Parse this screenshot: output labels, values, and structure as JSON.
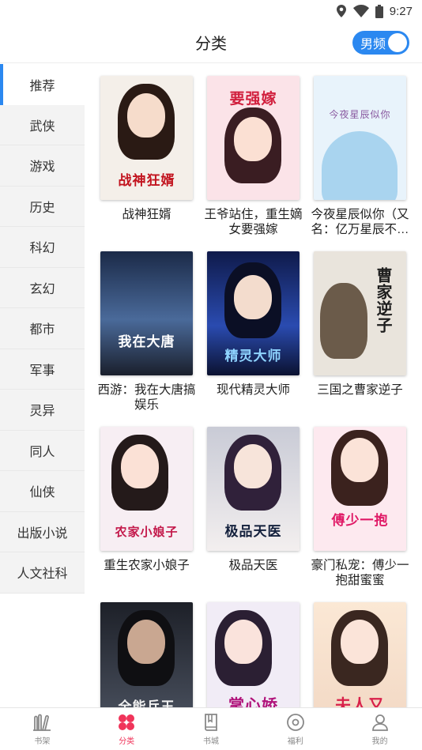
{
  "status_bar": {
    "time": "9:27"
  },
  "header": {
    "title": "分类",
    "toggle_label": "男频"
  },
  "sidebar": {
    "items": [
      {
        "label": "推荐"
      },
      {
        "label": "武侠"
      },
      {
        "label": "游戏"
      },
      {
        "label": "历史"
      },
      {
        "label": "科幻"
      },
      {
        "label": "玄幻"
      },
      {
        "label": "都市"
      },
      {
        "label": "军事"
      },
      {
        "label": "灵异"
      },
      {
        "label": "同人"
      },
      {
        "label": "仙侠"
      },
      {
        "label": "出版小说"
      },
      {
        "label": "人文社科"
      }
    ]
  },
  "books": [
    {
      "title": "战神狂婿",
      "cover_text": "战神狂婿",
      "bg": "#f4efe9",
      "accent": "#c2141f"
    },
    {
      "title": "王爷站住，重生嫡女要强嫁",
      "cover_text": "要强嫁",
      "bg": "#fbe3e8",
      "accent": "#d11f3d"
    },
    {
      "title": "今夜星辰似你（又名：亿万星辰不…",
      "cover_text": "今夜星辰似你",
      "bg": "#e8f3fb",
      "accent": "#8a5aa0"
    },
    {
      "title": "西游：我在大唐搞娱乐",
      "cover_text": "我在大唐",
      "bg": "#2a3f66",
      "accent": "#ffffff"
    },
    {
      "title": "现代精灵大师",
      "cover_text": "精灵大师",
      "bg": "#1b2a6b",
      "accent": "#8fd4ff"
    },
    {
      "title": "三国之曹家逆子",
      "cover_text": "曹家逆子",
      "bg": "#e9e4dc",
      "accent": "#1d1d1d"
    },
    {
      "title": "重生农家小娘子",
      "cover_text": "农家小娘子",
      "bg": "#f7eef3",
      "accent": "#c3184a"
    },
    {
      "title": "极品天医",
      "cover_text": "极品天医",
      "bg": "#d9dbe3",
      "accent": "#14213d"
    },
    {
      "title": "豪门私宠：傅少一抱甜蜜蜜",
      "cover_text": "傅少一抱",
      "bg": "#fde9ef",
      "accent": "#e01966"
    },
    {
      "title": "",
      "cover_text": "全能兵王",
      "bg": "#2b2f3a",
      "accent": "#f2f2f2"
    },
    {
      "title": "",
      "cover_text": "掌心娇",
      "bg": "#f1ecf6",
      "accent": "#b0127a"
    },
    {
      "title": "",
      "cover_text": "夫人又",
      "bg": "#f5e6d8",
      "accent": "#d8204a"
    }
  ],
  "bottom_nav": [
    {
      "label": "书架",
      "icon": "bookshelf-icon"
    },
    {
      "label": "分类",
      "icon": "category-icon"
    },
    {
      "label": "书城",
      "icon": "bookstore-icon"
    },
    {
      "label": "福利",
      "icon": "welfare-icon"
    },
    {
      "label": "我的",
      "icon": "profile-icon"
    }
  ],
  "colors": {
    "accent_blue": "#2b88f0",
    "active_red": "#f0345a"
  }
}
